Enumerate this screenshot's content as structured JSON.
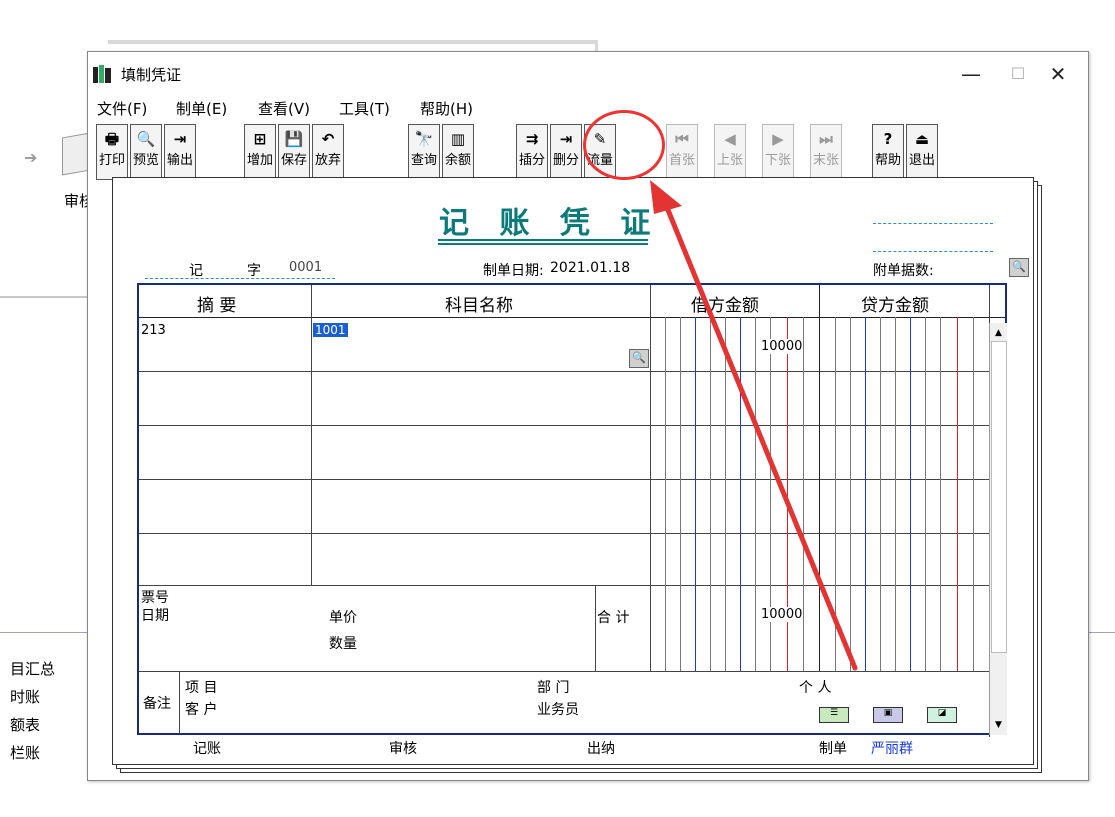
{
  "background": {
    "audit_label": "审核",
    "left_list": [
      "目汇总",
      "时账",
      "额表",
      "栏账"
    ]
  },
  "window": {
    "title": "填制凭证",
    "minimize": "—",
    "maximize": "☐",
    "close": "✕"
  },
  "menu": {
    "items": [
      "文件(F)",
      "制单(E)",
      "查看(V)",
      "工具(T)",
      "帮助(H)"
    ]
  },
  "toolbar": {
    "buttons": [
      {
        "label": "打印",
        "icon": "🖶"
      },
      {
        "label": "预览",
        "icon": "🔍"
      },
      {
        "label": "输出",
        "icon": "⇥"
      },
      {
        "label": "增加",
        "icon": "⊞"
      },
      {
        "label": "保存",
        "icon": "💾"
      },
      {
        "label": "放弃",
        "icon": "↶"
      },
      {
        "label": "查询",
        "icon": "🔭"
      },
      {
        "label": "余额",
        "icon": "▥"
      },
      {
        "label": "插分",
        "icon": "⇉"
      },
      {
        "label": "删分",
        "icon": "⇥"
      },
      {
        "label": "流量",
        "icon": "✎"
      },
      {
        "label": "首张",
        "icon": "⏮"
      },
      {
        "label": "上张",
        "icon": "◀"
      },
      {
        "label": "下张",
        "icon": "▶"
      },
      {
        "label": "末张",
        "icon": "⏭"
      },
      {
        "label": "帮助",
        "icon": "?"
      },
      {
        "label": "退出",
        "icon": "⏏"
      }
    ]
  },
  "voucher": {
    "title": "记 账 凭 证",
    "type_label": "记",
    "word_label": "字",
    "number": "0001",
    "date_label": "制单日期:",
    "date": "2021.01.18",
    "attachments_label": "附单据数:",
    "columns": {
      "summary": "摘 要",
      "account": "科目名称",
      "debit": "借方金额",
      "credit": "贷方金额"
    },
    "rows": [
      {
        "summary": "213",
        "account": "1001",
        "debit": "10000",
        "credit": ""
      }
    ],
    "bottom": {
      "ticket_no": "票号",
      "date": "日期",
      "unit_price": "单价",
      "quantity": "数量",
      "total_label": "合 计",
      "total_debit": "10000",
      "remark": "备注",
      "project": "项  目",
      "customer": "客  户",
      "department": "部  门",
      "salesman": "业务员",
      "individual": "个  人"
    },
    "footer": {
      "bookkeeping": "记账",
      "audit": "审核",
      "cashier": "出纳",
      "maker": "制单",
      "maker_name": "严丽群"
    }
  },
  "colors": {
    "title_teal": "#0a7a7a",
    "grid_border": "#1a2a7a",
    "annotation_red": "#e33333"
  }
}
